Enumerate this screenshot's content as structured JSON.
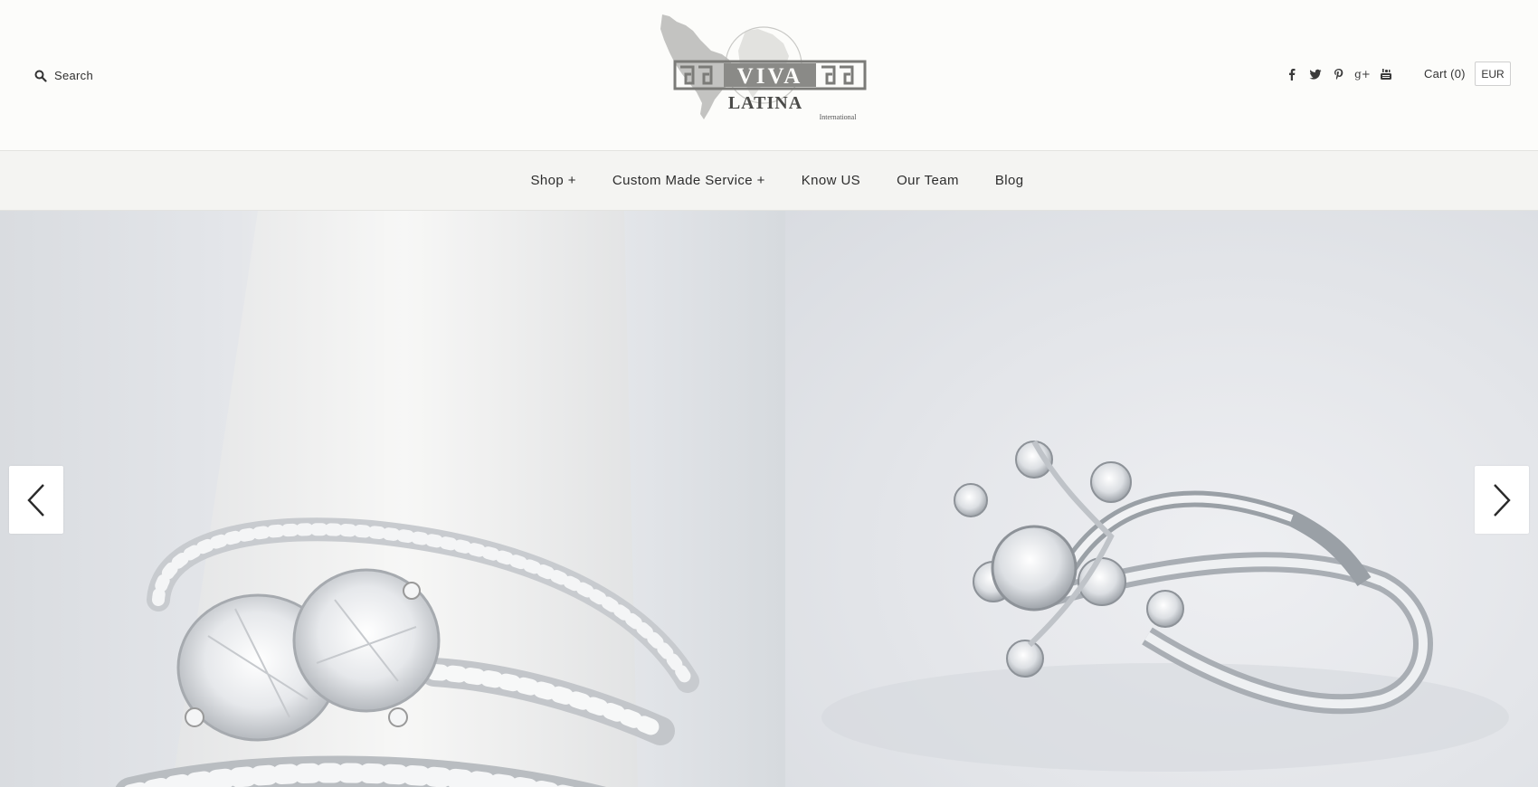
{
  "header": {
    "search_label": "Search",
    "logo": {
      "name": "VIVA LATINA",
      "line1": "VIVA",
      "line2": "LATINA",
      "line3": "International"
    },
    "social_icons": [
      "facebook-icon",
      "twitter-icon",
      "pinterest-icon",
      "google-plus-icon",
      "youtube-icon"
    ],
    "google_plus_text": "g+",
    "cart_label": "Cart (0)",
    "currency": "EUR"
  },
  "nav": {
    "items": [
      {
        "label": "Shop +"
      },
      {
        "label": "Custom Made Service +"
      },
      {
        "label": "Know US"
      },
      {
        "label": "Our Team"
      },
      {
        "label": "Blog"
      }
    ]
  },
  "hero": {
    "slides": [
      {
        "subject": "diamond-ring-stack-image"
      },
      {
        "subject": "diamond-flower-ring-image"
      }
    ],
    "prev_icon": "chevron-left-icon",
    "next_icon": "chevron-right-icon"
  },
  "colors": {
    "header_bg": "#fcfcfa",
    "nav_bg": "#f4f4f2",
    "text": "#2d2d2d",
    "logo_gray": "#7b7b78"
  }
}
